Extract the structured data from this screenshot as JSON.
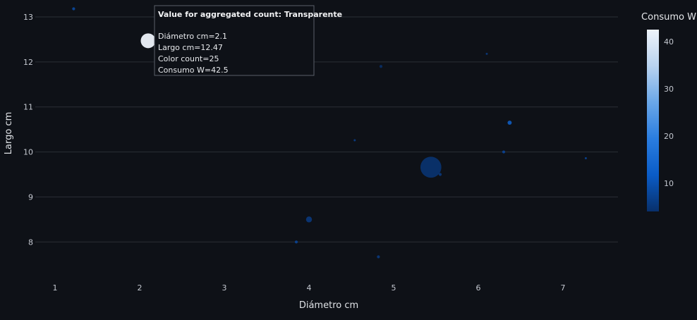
{
  "chart_data": {
    "type": "scatter",
    "xlabel": "Diámetro cm",
    "ylabel": "Largo cm",
    "xlim": [
      0.55,
      7.65
    ],
    "ylim": [
      7.3,
      13.25
    ],
    "x_ticks": [
      1,
      2,
      3,
      4,
      5,
      6,
      7
    ],
    "y_ticks": [
      8,
      9,
      10,
      11,
      12,
      13
    ],
    "grid": true,
    "size_field": "Color count",
    "color_field": "Consumo W",
    "colorbar": {
      "title": "Consumo W",
      "range": [
        4,
        42.5
      ],
      "ticks": [
        10,
        20,
        30,
        40
      ],
      "colors": [
        "#08306b",
        "#0a5cc7",
        "#2a7de0",
        "#6aa7e8",
        "#b9d3ef",
        "#eef3fa"
      ]
    },
    "points": [
      {
        "x": 1.22,
        "y": 13.18,
        "count": 1,
        "consumo": 9
      },
      {
        "x": 2.1,
        "y": 12.47,
        "count": 25,
        "consumo": 42.5
      },
      {
        "x": 4.85,
        "y": 11.9,
        "count": 1,
        "consumo": 4
      },
      {
        "x": 6.1,
        "y": 12.18,
        "count": 0.5,
        "consumo": 6
      },
      {
        "x": 6.37,
        "y": 10.65,
        "count": 2,
        "consumo": 13
      },
      {
        "x": 4.54,
        "y": 10.26,
        "count": 0.5,
        "consumo": 7
      },
      {
        "x": 6.3,
        "y": 10.0,
        "count": 1,
        "consumo": 8
      },
      {
        "x": 7.27,
        "y": 9.86,
        "count": 0.5,
        "consumo": 8
      },
      {
        "x": 5.44,
        "y": 9.66,
        "count": 50,
        "consumo": 5
      },
      {
        "x": 5.55,
        "y": 9.5,
        "count": 1,
        "consumo": 6
      },
      {
        "x": 4.0,
        "y": 8.5,
        "count": 4,
        "consumo": 6
      },
      {
        "x": 3.85,
        "y": 8.0,
        "count": 1,
        "consumo": 8
      },
      {
        "x": 4.82,
        "y": 7.67,
        "count": 1,
        "consumo": 6
      }
    ],
    "hover": {
      "title": "Value for aggregated count: Transparente",
      "lines": [
        "Diámetro cm=2.1",
        "Largo cm=12.47",
        "Color count=25",
        "Consumo W=42.5"
      ],
      "point_index": 1
    }
  }
}
